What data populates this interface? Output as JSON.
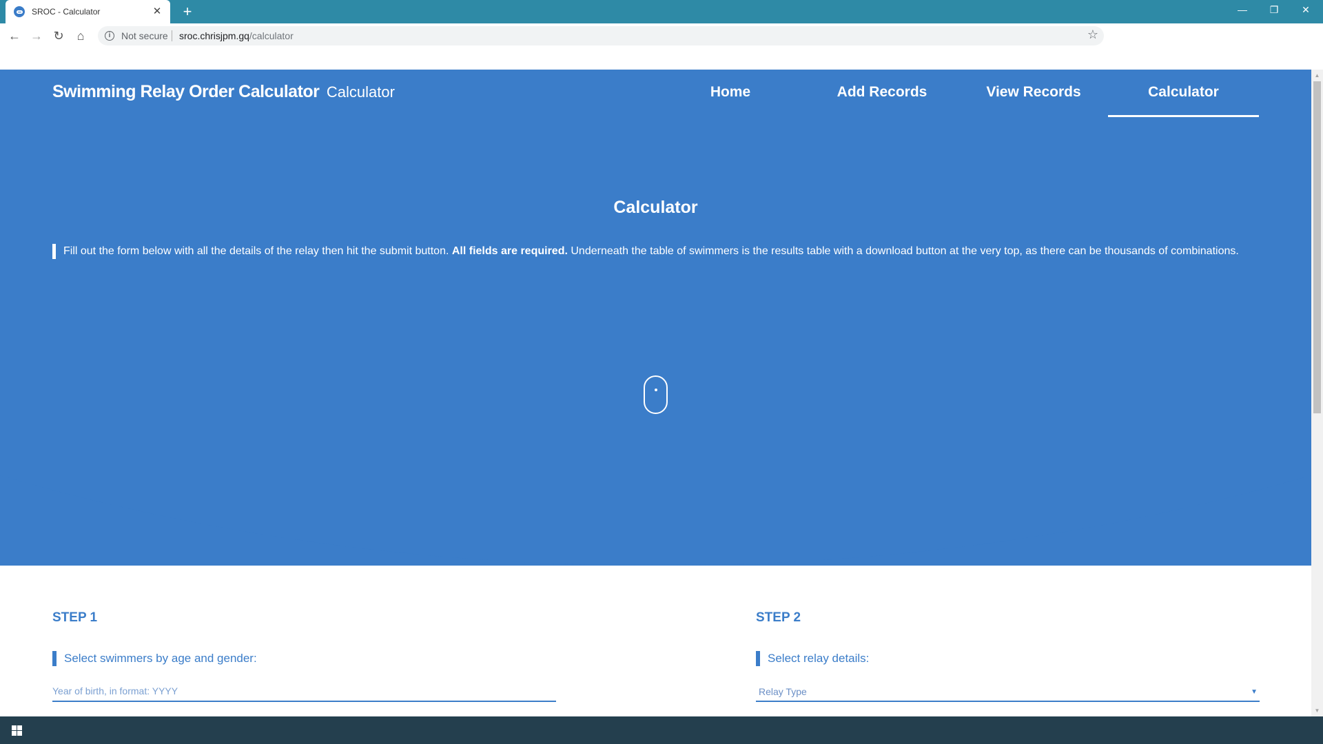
{
  "browser": {
    "tab_title": "SROC - Calculator",
    "tab_close": "✕",
    "new_tab": "+",
    "security": "Not secure",
    "url_host": "sroc.chrisjpm.gq",
    "url_path": "/calculator",
    "window_controls": {
      "minimize": "—",
      "restore": "❐",
      "close": "✕"
    }
  },
  "site": {
    "brand": "Swimming Relay Order Calculator",
    "brand_sub": "Calculator",
    "nav": [
      {
        "label": "Home",
        "active": false
      },
      {
        "label": "Add Records",
        "active": false
      },
      {
        "label": "View Records",
        "active": false
      },
      {
        "label": "Calculator",
        "active": true
      }
    ]
  },
  "hero": {
    "heading": "Calculator",
    "lead_before": "Fill out the form below with all the details of the relay then hit the submit button. ",
    "lead_bold": "All fields are required.",
    "lead_after": " Underneath the table of swimmers is the results table with a download button at the very top, as there can be thousands of combinations."
  },
  "steps": [
    {
      "title": "STEP 1",
      "label": "Select swimmers by age and gender:",
      "field_placeholder": "Year of birth, in format: YYYY"
    },
    {
      "title": "STEP 2",
      "label": "Select relay details:",
      "select_value": "Relay Type"
    }
  ],
  "icons": {
    "back": "arrow-left-icon",
    "forward": "arrow-right-icon",
    "reload": "reload-icon",
    "home": "home-icon",
    "info": "info-icon",
    "bookmark": "star-icon",
    "scroll": "mouse-scroll-icon",
    "start": "windows-icon"
  },
  "colors": {
    "brand_blue": "#3b7dc9",
    "titlebar": "#2e8aa6",
    "taskbar": "#243f4e"
  }
}
